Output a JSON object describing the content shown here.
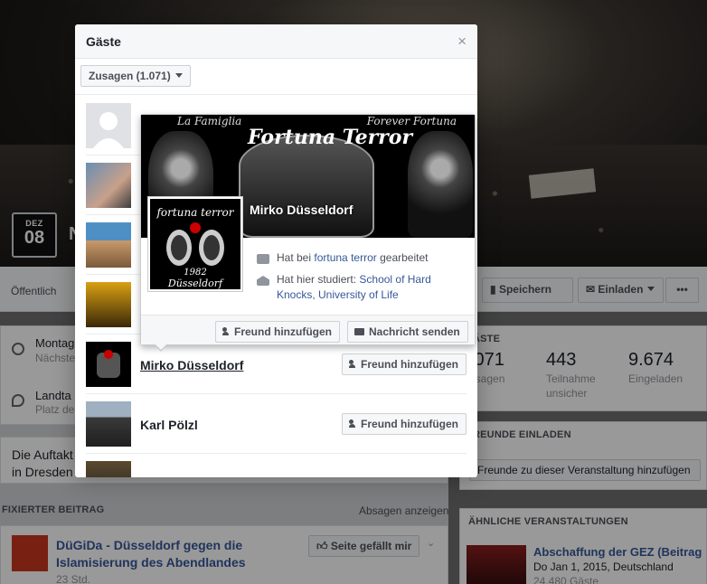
{
  "background_page": {
    "date": {
      "month": "DEZ",
      "day": "08"
    },
    "title_fragment": "N",
    "public_label": "Öffentlich",
    "buttons": {
      "save": "Speichern",
      "invite": "Einladen",
      "more": "•••"
    },
    "info": {
      "time_line1": "Montag",
      "time_line2": "Nächste",
      "place_line1": "Landta",
      "place_line2": "Platz de"
    },
    "description": [
      "Die Auftakt",
      "in Dresden"
    ],
    "pinned_label": "FIXIERTER BEITRAG",
    "show_cancellations": "Absagen anzeigen",
    "pinned_post": {
      "title": "DüGiDa - Düsseldorf gegen die Islamisierung des Abendlandes",
      "time": "23 Std.",
      "like_button": "Seite gefällt mir"
    },
    "stats": {
      "header": "ÄSTE",
      "items": [
        {
          "value": ".071",
          "label": "usagen"
        },
        {
          "value": "443",
          "label": "Teilnahme unsicher"
        },
        {
          "value": "9.674",
          "label": "Eingeladen"
        }
      ]
    },
    "invite_friends": {
      "header": "REUNDE EINLADEN",
      "button": "Freunde zu dieser Veranstaltung hinzufügen"
    },
    "similar_events": {
      "header": "ÄHNLICHE VERANSTALTUNGEN",
      "item": {
        "title": "Abschaffung der GEZ (Beitrag",
        "date": "Do Jan 1, 2015, Deutschland",
        "guests": "24.480 Gäste"
      }
    }
  },
  "dialog": {
    "title": "Gäste",
    "close": "×",
    "filter": "Zusagen (1.071)",
    "guests": [
      {
        "name": "",
        "avatar": "default"
      },
      {
        "name": "",
        "avatar": "photo"
      },
      {
        "name": "",
        "avatar": "photo"
      },
      {
        "name": "",
        "avatar": "photo"
      },
      {
        "name": "Mirko Düsseldorf",
        "button": "Freund hinzufügen",
        "avatar": "logo"
      },
      {
        "name": "Karl Pölzl",
        "button": "Freund hinzufügen",
        "avatar": "photo"
      }
    ]
  },
  "hovercard": {
    "name": "Mirko Düsseldorf",
    "cover_texts": {
      "left": "La Famiglia",
      "center": "Fortuna Terror",
      "right": "Forever Fortuna"
    },
    "work": {
      "prefix": "Hat bei",
      "link": "fortuna terror",
      "suffix": "gearbeitet"
    },
    "education": {
      "prefix": "Hat hier studiert:",
      "link": "School of Hard Knocks, University of Life"
    },
    "buttons": {
      "add_friend": "Freund hinzufügen",
      "send_message": "Nachricht senden"
    },
    "profile_logo_text": {
      "top": "fortuna terror",
      "year": "1982",
      "bottom": "Düsseldorf"
    }
  },
  "colors": {
    "link": "#365899",
    "button_bg": "#f6f7f9",
    "border": "#ced0d4"
  }
}
